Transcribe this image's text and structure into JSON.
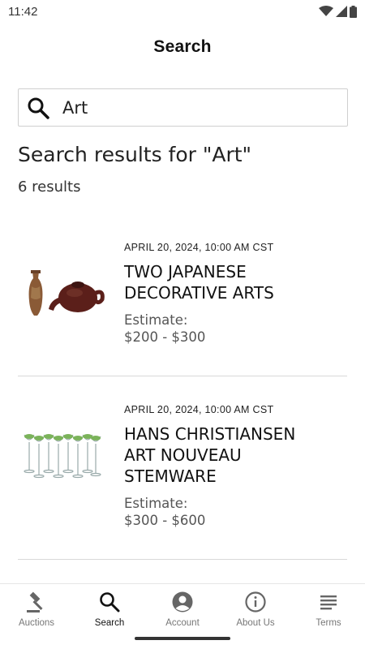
{
  "status_bar": {
    "time": "11:42"
  },
  "app_bar": {
    "title": "Search"
  },
  "search": {
    "value": "Art",
    "icon": "search-icon"
  },
  "results": {
    "heading": "Search results for \"Art\"",
    "count": "6 results",
    "items": [
      {
        "date": "APRIL 20, 2024, 10:00 AM CST",
        "title_line1": "TWO JAPANESE",
        "title_line2": "DECORATIVE ARTS",
        "title_line3": "",
        "estimate_label": "Estimate:",
        "estimate_value": "$200 - $300"
      },
      {
        "date": "APRIL 20, 2024, 10:00 AM CST",
        "title_line1": "HANS CHRISTIANSEN",
        "title_line2": "ART NOUVEAU",
        "title_line3": "STEMWARE",
        "estimate_label": "Estimate:",
        "estimate_value": "$300 - $600"
      }
    ]
  },
  "bottom_nav": {
    "items": [
      {
        "label": "Auctions",
        "icon": "gavel-icon"
      },
      {
        "label": "Search",
        "icon": "search-icon"
      },
      {
        "label": "Account",
        "icon": "account-circle-icon"
      },
      {
        "label": "About Us",
        "icon": "info-icon"
      },
      {
        "label": "Terms",
        "icon": "menu-lines-icon"
      }
    ],
    "active": "Search"
  }
}
